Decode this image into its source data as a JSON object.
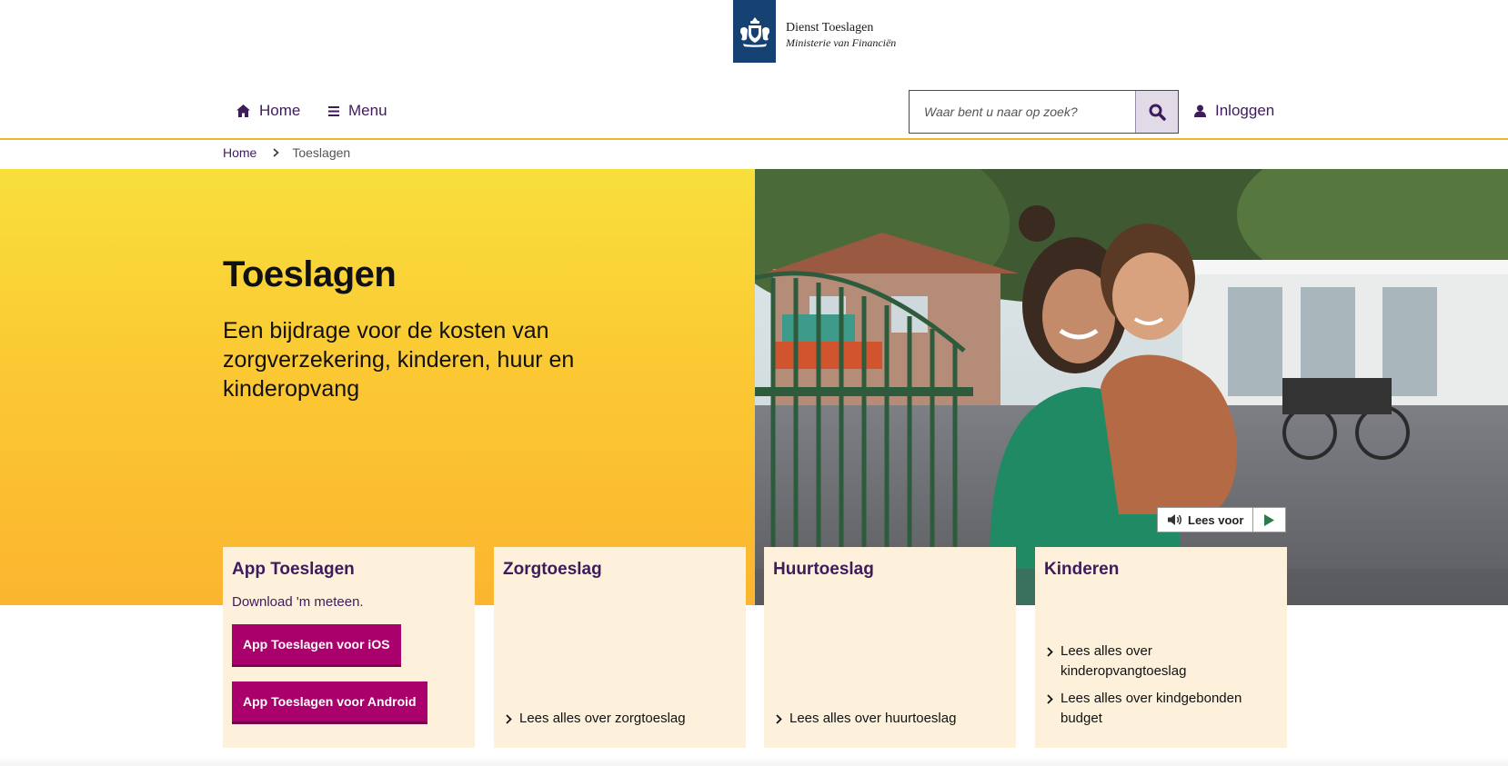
{
  "logo": {
    "line1": "Dienst Toeslagen",
    "line2": "Ministerie van Financiën",
    "brand_color": "#154273"
  },
  "nav": {
    "home_label": "Home",
    "menu_label": "Menu",
    "search_placeholder": "Waar bent u naar op zoek?",
    "login_label": "Inloggen",
    "accent_color": "#3e1b5b",
    "border_color": "#f2b430"
  },
  "breadcrumb": {
    "home": "Home",
    "current": "Toeslagen"
  },
  "hero": {
    "title": "Toeslagen",
    "subtitle": "Een bijdrage voor de kosten van zorgverzekering, kinderen, huur en kinderopvang"
  },
  "readspeaker": {
    "label": "Lees voor"
  },
  "cards": [
    {
      "title": "App Toeslagen",
      "text": "Download 'm meteen.",
      "buttons": [
        "App Toeslagen voor iOS",
        "App Toeslagen voor Android"
      ],
      "button_color": "#a9006b"
    },
    {
      "title": "Zorgtoeslag",
      "links": [
        "Lees alles over zorgtoeslag"
      ]
    },
    {
      "title": "Huurtoeslag",
      "links": [
        "Lees alles over huurtoeslag"
      ]
    },
    {
      "title": "Kinderen",
      "links": [
        "Lees alles over kinderopvangtoeslag",
        "Lees alles over kindgebonden budget"
      ]
    }
  ],
  "icons": [
    "crest-icon",
    "home-icon",
    "menu-icon",
    "search-icon",
    "user-icon",
    "chevron-right-icon",
    "speaker-icon",
    "play-icon"
  ]
}
